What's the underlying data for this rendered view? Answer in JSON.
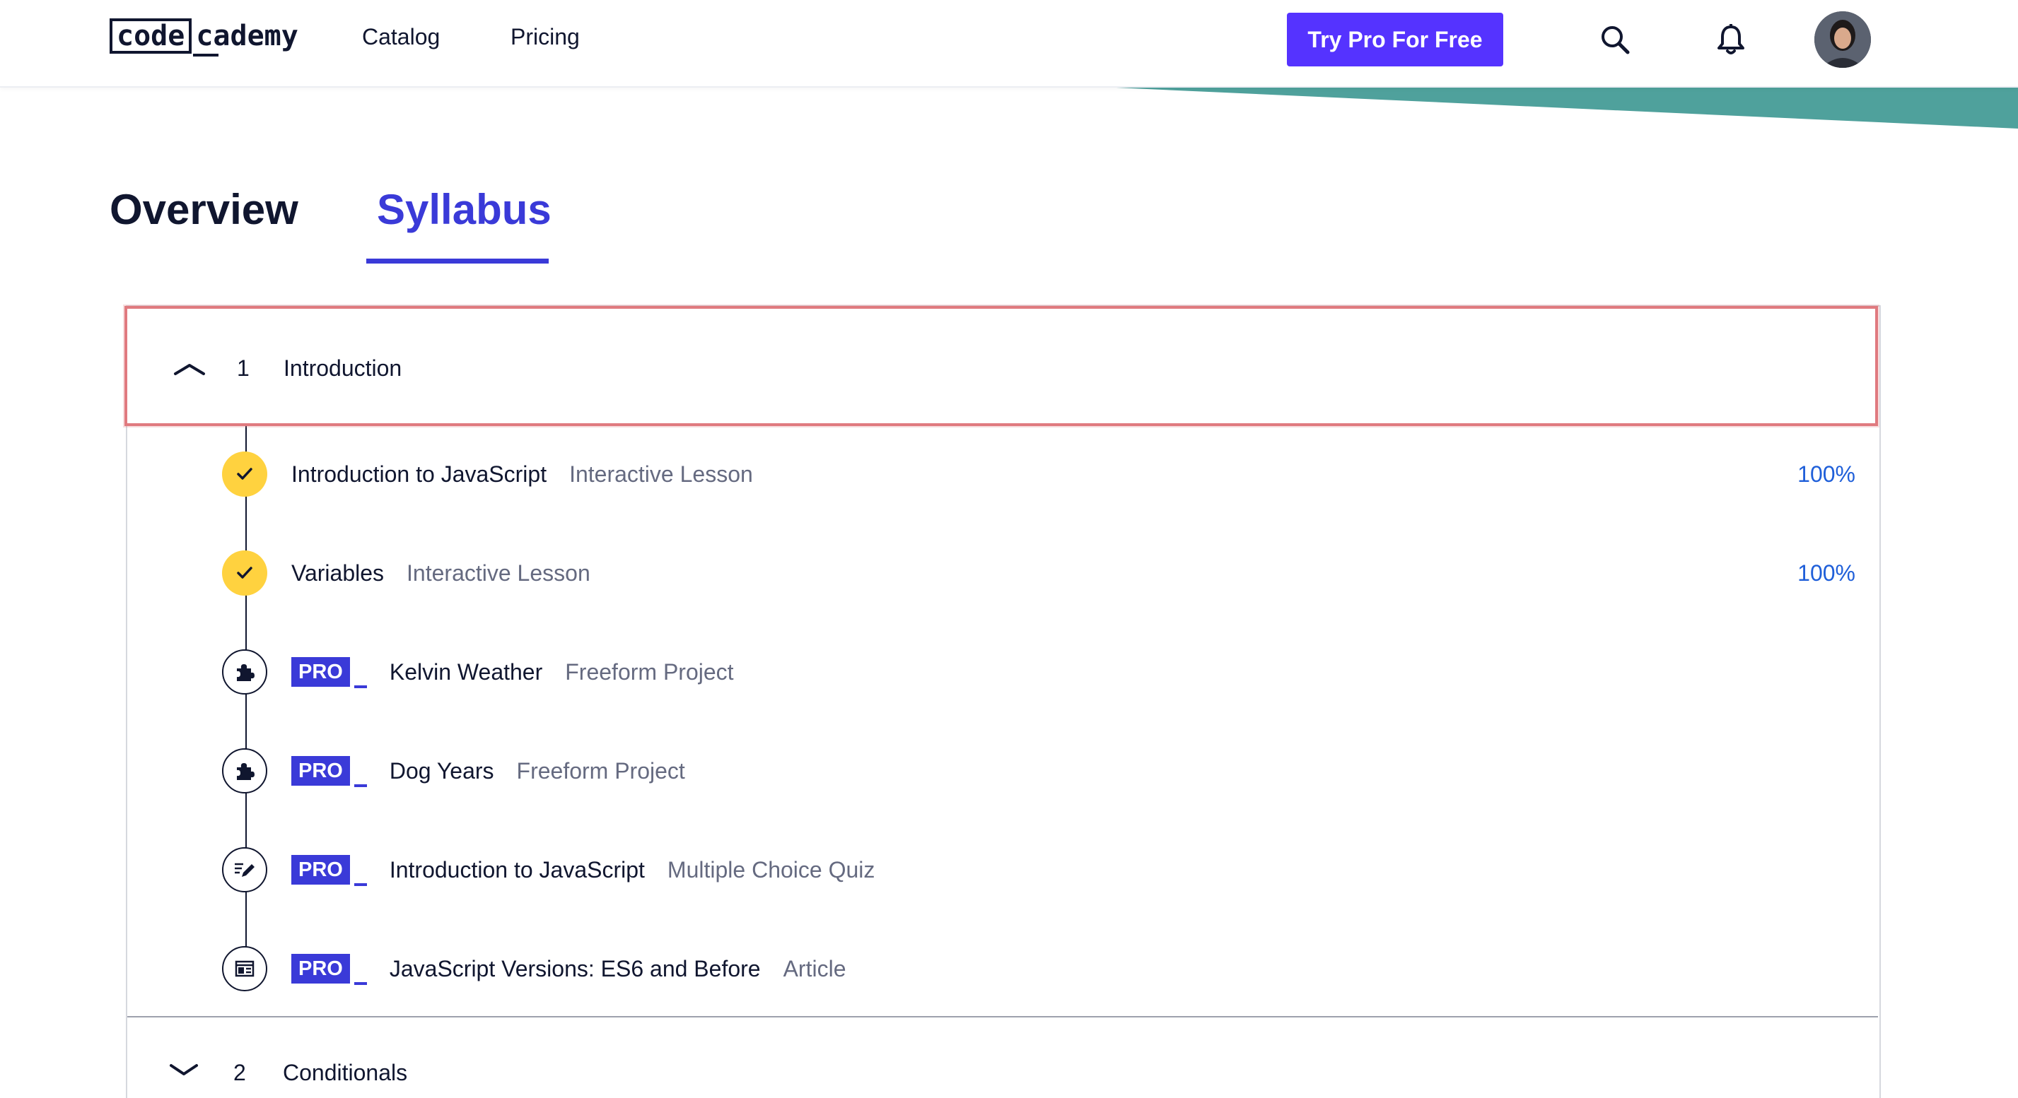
{
  "header": {
    "logo_code": "code",
    "logo_rest": "cademy",
    "nav": [
      "Catalog",
      "Pricing"
    ],
    "cta_label": "Try Pro For Free",
    "accent_color": "#5533ff"
  },
  "tabs": [
    {
      "label": "Overview",
      "active": false
    },
    {
      "label": "Syllabus",
      "active": true
    }
  ],
  "module": {
    "number": "1",
    "title": "Introduction",
    "expanded": true
  },
  "items": [
    {
      "title": "Introduction to JavaScript",
      "type": "Interactive Lesson",
      "progress": "100%",
      "pro": false,
      "icon": "check-icon"
    },
    {
      "title": "Variables",
      "type": "Interactive Lesson",
      "progress": "100%",
      "pro": false,
      "icon": "check-icon"
    },
    {
      "title": "Kelvin Weather",
      "type": "Freeform Project",
      "pro": true,
      "pro_label": "PRO",
      "icon": "puzzle-icon"
    },
    {
      "title": "Dog Years",
      "type": "Freeform Project",
      "pro": true,
      "pro_label": "PRO",
      "icon": "puzzle-icon"
    },
    {
      "title": "Introduction to JavaScript",
      "type": "Multiple Choice Quiz",
      "pro": true,
      "pro_label": "PRO",
      "icon": "quiz-icon"
    },
    {
      "title": "JavaScript Versions: ES6 and Before",
      "type": "Article",
      "pro": true,
      "pro_label": "PRO",
      "icon": "article-icon"
    }
  ],
  "next_module": {
    "number": "2",
    "title": "Conditionals"
  }
}
